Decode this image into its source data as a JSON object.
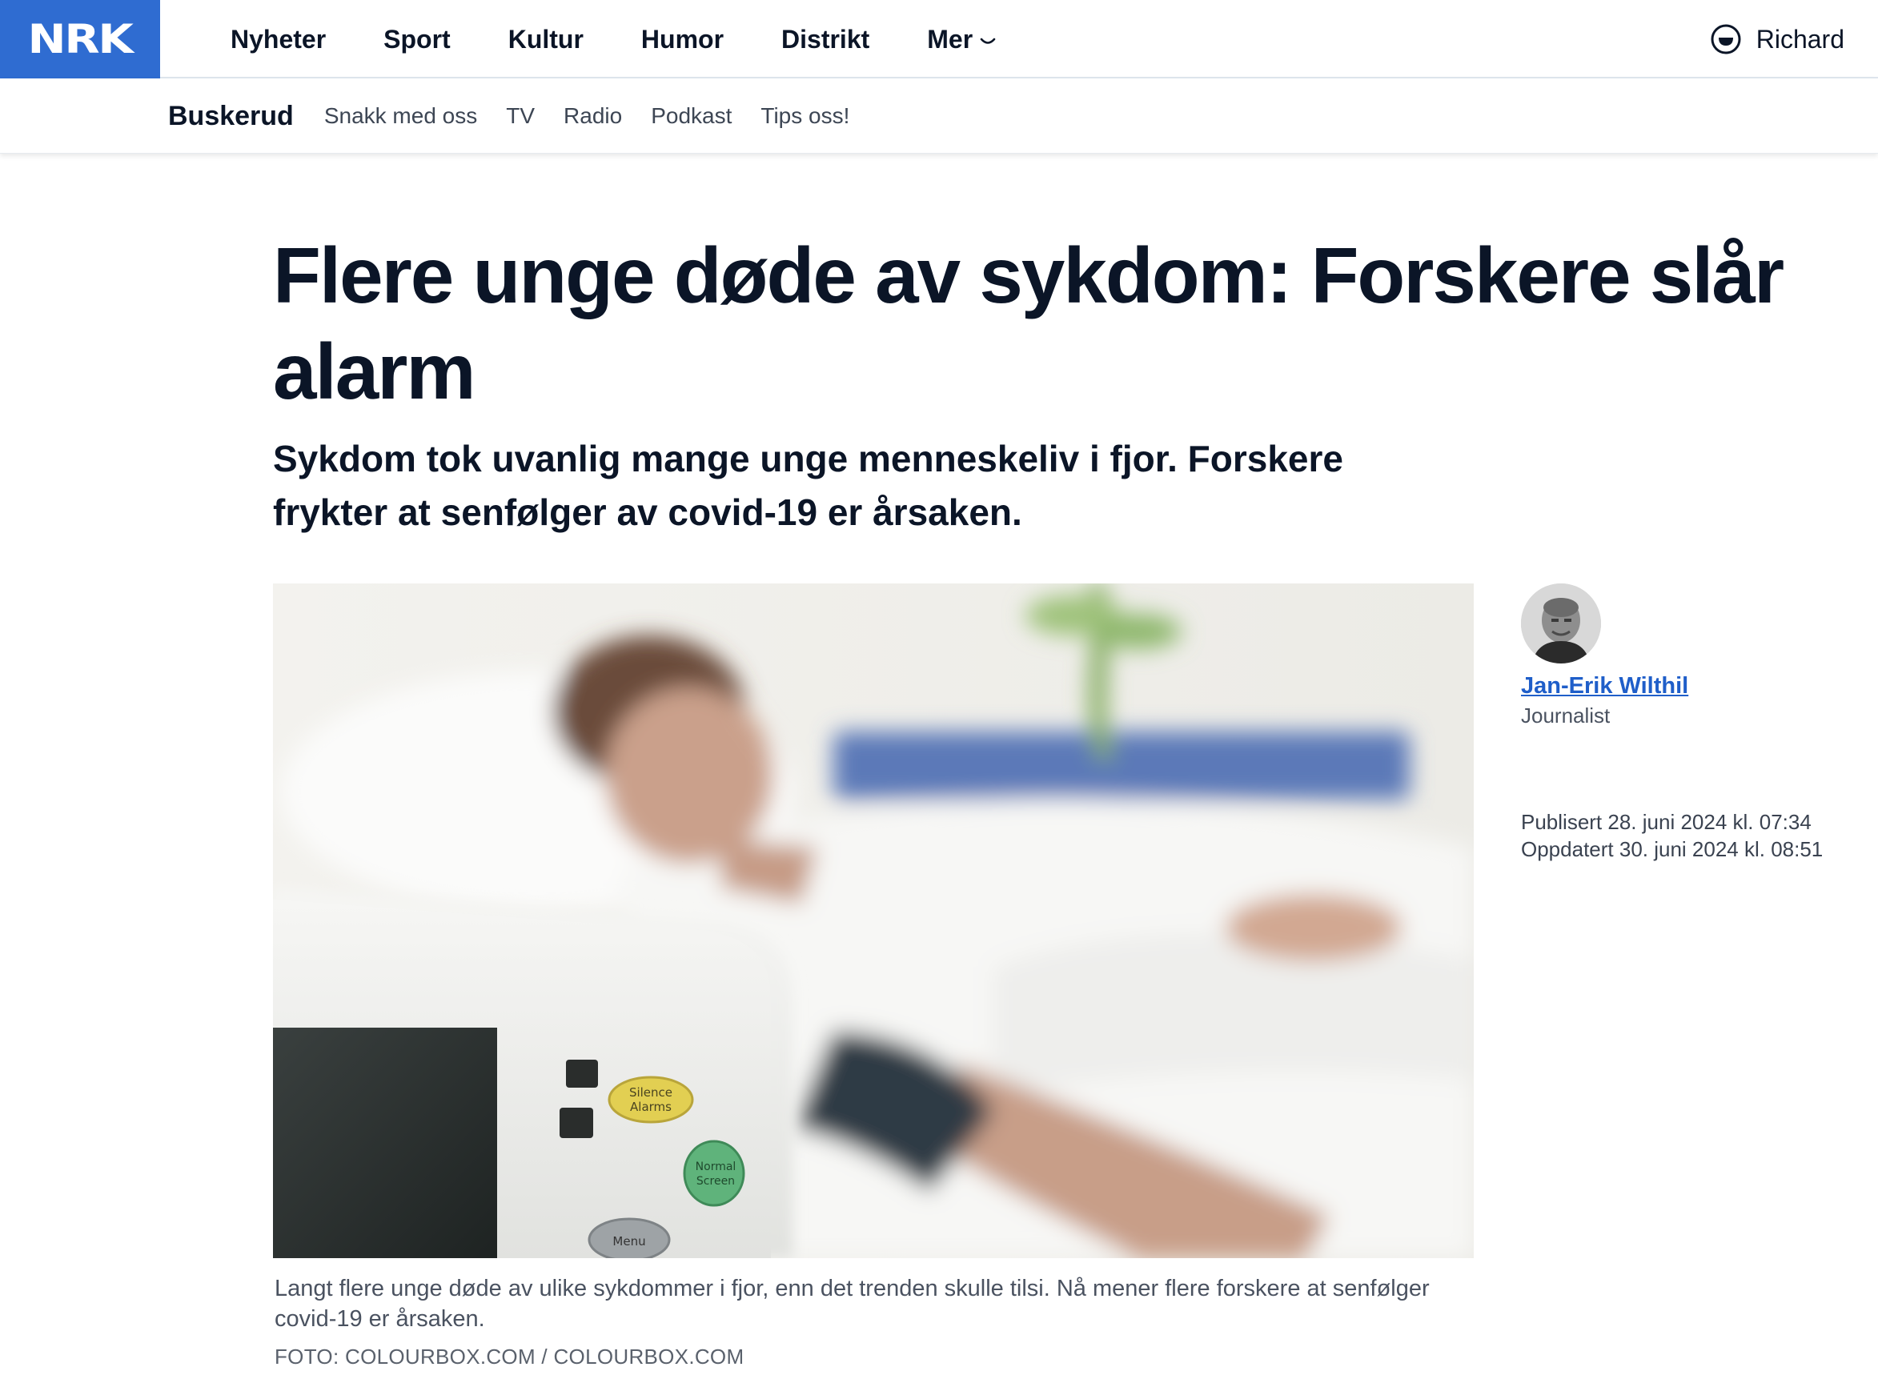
{
  "nav": {
    "logo": "NRK",
    "items": [
      "Nyheter",
      "Sport",
      "Kultur",
      "Humor",
      "Distrikt"
    ],
    "more": "Mer",
    "user": "Richard"
  },
  "subnav": {
    "region": "Buskerud",
    "links": [
      "Snakk med oss",
      "TV",
      "Radio",
      "Podkast",
      "Tips oss!"
    ]
  },
  "article": {
    "headline": "Flere unge døde av sykdom: Forskere slår alarm",
    "lead": "Sykdom tok uvanlig mange unge menneskeliv i fjor. Forskere frykter at senfølger av covid-19 er årsaken.",
    "image": {
      "device_buttons": [
        "Silence Alarms",
        "Normal Screen",
        "Menu"
      ],
      "caption": "Langt flere unge døde av ulike sykdommer i fjor, enn det trenden skulle tilsi. Nå mener flere forskere at senfølger covid-19 er årsaken.",
      "credit": "FOTO: COLOURBOX.COM / COLOURBOX.COM"
    },
    "byline": {
      "author": "Jan-Erik Wilthil",
      "role": "Journalist",
      "published": "Publisert 28. juni 2024 kl. 07:34",
      "updated": "Oppdatert 30. juni 2024 kl. 08:51"
    }
  },
  "colors": {
    "brand": "#2f6cd1",
    "text": "#0b1527",
    "link": "#1f5ec9"
  }
}
